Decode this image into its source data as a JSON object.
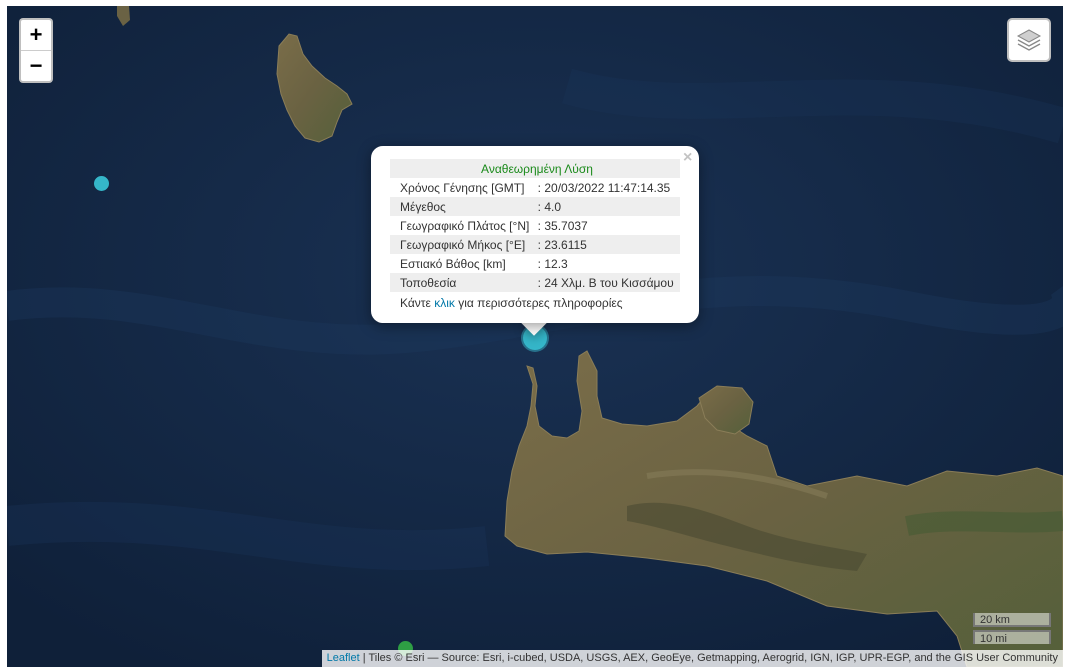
{
  "map": {
    "zoom_in_label": "+",
    "zoom_out_label": "−",
    "water_color": "#12253f",
    "land_color": "#6e6443"
  },
  "markers": {
    "selected_color": "#35b6c9",
    "other_color": "#35b6c9",
    "green_color": "#2e9e44"
  },
  "popup": {
    "close_label": "×",
    "title": "Αναθεωρημένη Λύση",
    "rows": [
      {
        "label": "Χρόνος Γένησης [GMT]",
        "value": ": 20/03/2022 11:47:14.35"
      },
      {
        "label": "Μέγεθος",
        "value": ": 4.0"
      },
      {
        "label": "Γεωγραφικό Πλάτος [°N]",
        "value": ": 35.7037"
      },
      {
        "label": "Γεωγραφικό Μήκος [°E]",
        "value": ": 23.6115"
      },
      {
        "label": "Εστιακό Βάθος [km]",
        "value": ": 12.3"
      },
      {
        "label": "Τοποθεσία",
        "value": ": 24 Χλμ. Β του Κισσάμου"
      }
    ],
    "more_prefix": "Κάντε ",
    "more_link": "κλικ",
    "more_suffix": " για περισσότερες πληροφορίες"
  },
  "scale": {
    "metric": "20 km",
    "imperial": "10 mi"
  },
  "attribution": {
    "leaflet": "Leaflet",
    "text": " | Tiles © Esri — Source: Esri, i-cubed, USDA, USGS, AEX, GeoEye, Getmapping, Aerogrid, IGN, IGP, UPR-EGP, and the GIS User Community"
  }
}
